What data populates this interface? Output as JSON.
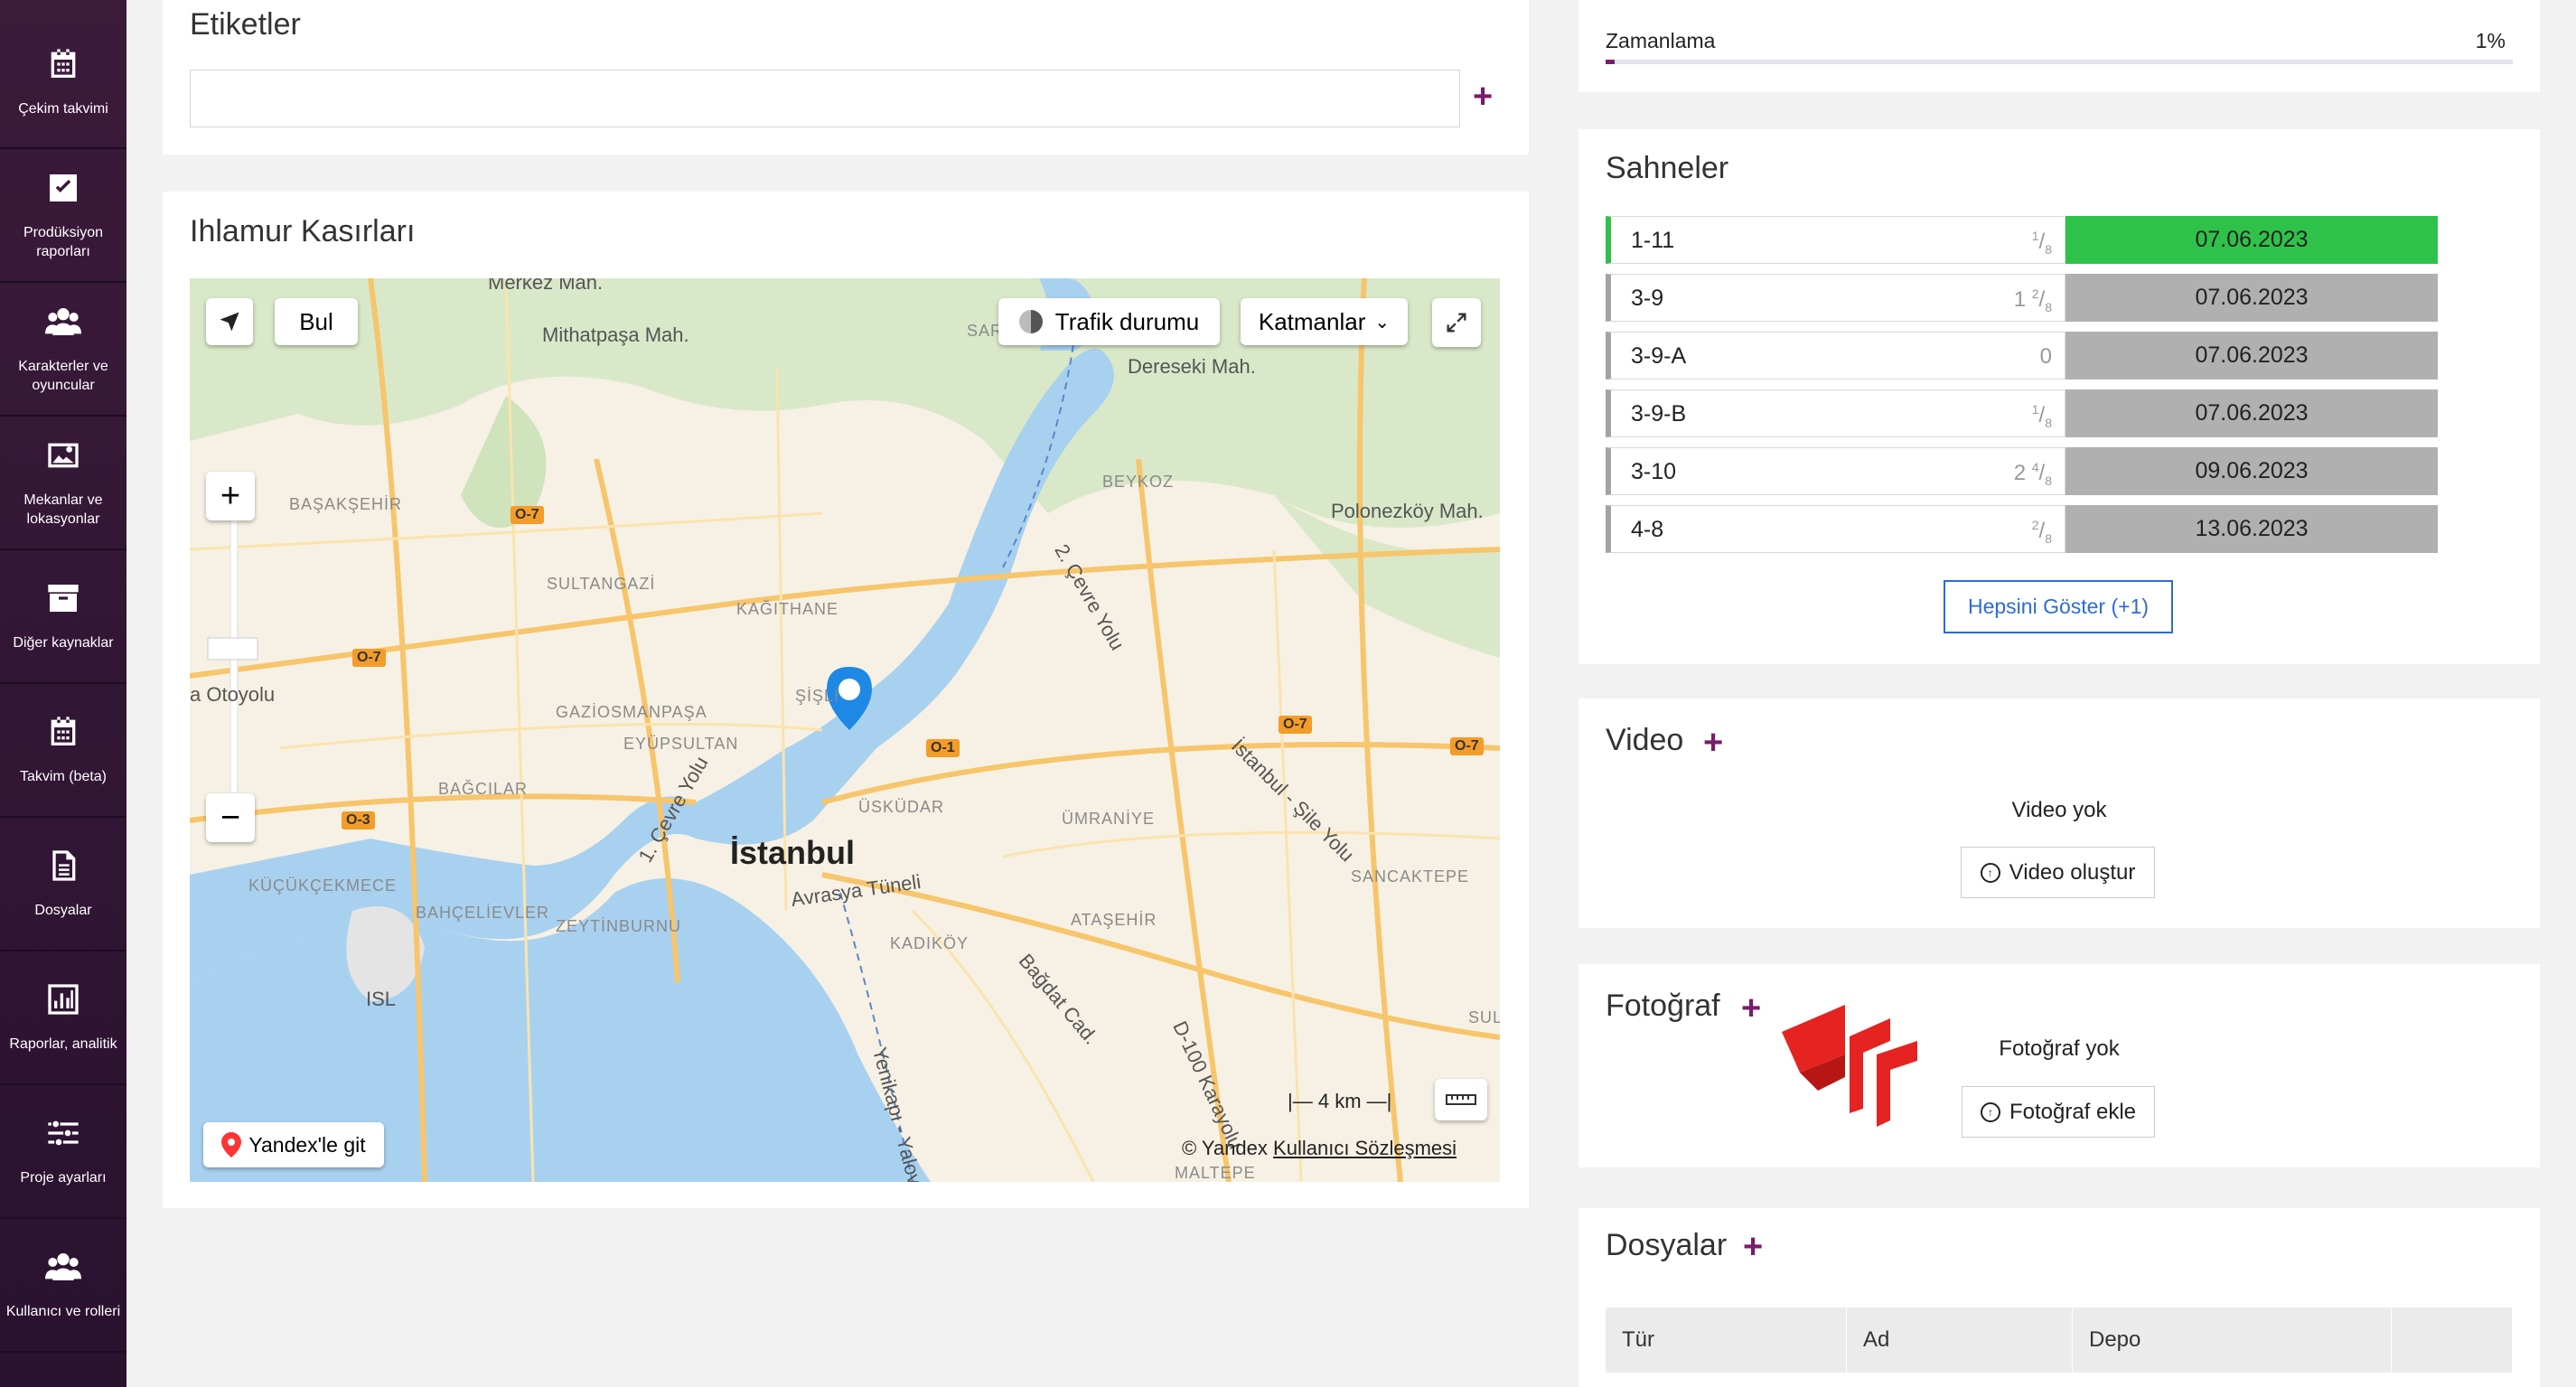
{
  "sidebar": {
    "items": [
      {
        "label": "Çekim takvimi",
        "icon": "calendar-icon"
      },
      {
        "label": "Prodüksiyon raporları",
        "icon": "checkbox-icon"
      },
      {
        "label": "Karakterler ve oyuncular",
        "icon": "users-icon"
      },
      {
        "label": "Mekanlar ve lokasyonlar",
        "icon": "image-icon"
      },
      {
        "label": "Diğer kaynaklar",
        "icon": "archive-icon"
      },
      {
        "label": "Takvim (beta)",
        "icon": "calendar-icon"
      },
      {
        "label": "Dosyalar",
        "icon": "document-icon"
      },
      {
        "label": "Raporlar, analitik",
        "icon": "bar-chart-icon"
      },
      {
        "label": "Proje ayarları",
        "icon": "sliders-icon"
      },
      {
        "label": "Kullanıcı ve rolleri",
        "icon": "users-icon"
      }
    ]
  },
  "tags": {
    "title": "Etiketler",
    "input_value": "",
    "add": "+"
  },
  "location": {
    "title": "Ihlamur Kasırları",
    "map": {
      "find_button": "Bul",
      "traffic_button": "Trafik durumu",
      "layers_button": "Katmanlar",
      "scale": "4 km",
      "yandex_button": "Yandex'le git",
      "copyright": "© Yandex",
      "terms_link": "Kullanıcı Sözleşmesi",
      "city_label": "İstanbul",
      "labels": [
        {
          "text": "Mithatpaşa Mah.",
          "cls": ""
        },
        {
          "text": "Dereseki Mah.",
          "cls": ""
        },
        {
          "text": "Polonezköy Mah.",
          "cls": ""
        },
        {
          "text": "BAŞAKŞEHİR",
          "cls": "small"
        },
        {
          "text": "SULTANGAZİ",
          "cls": "small"
        },
        {
          "text": "KAĞITHANE",
          "cls": "small"
        },
        {
          "text": "BEYKOZ",
          "cls": "small"
        },
        {
          "text": "GAZİOSMANPAŞA",
          "cls": "small"
        },
        {
          "text": "EYÜPSULTAN",
          "cls": "small"
        },
        {
          "text": "ŞİŞLİ",
          "cls": "small"
        },
        {
          "text": "BAĞCILAR",
          "cls": "small"
        },
        {
          "text": "ÜSKÜDAR",
          "cls": "small"
        },
        {
          "text": "ÜMRANİYE",
          "cls": "small"
        },
        {
          "text": "KÜÇÜKÇEKMECE",
          "cls": "small"
        },
        {
          "text": "BAHÇELİEVLER",
          "cls": "small"
        },
        {
          "text": "ZEYTİNBURNU",
          "cls": "small"
        },
        {
          "text": "KADIKÖY",
          "cls": "small"
        },
        {
          "text": "ATAŞEHİR",
          "cls": "small"
        },
        {
          "text": "SANCAKTEPE",
          "cls": "small"
        },
        {
          "text": "MALTEPE",
          "cls": "small"
        },
        {
          "text": "ISL",
          "cls": ""
        },
        {
          "text": "a Otoyolu",
          "cls": ""
        },
        {
          "text": "2. Çevre Yolu",
          "cls": ""
        },
        {
          "text": "1. Çevre Yolu",
          "cls": ""
        },
        {
          "text": "İstanbul - Şile Yolu",
          "cls": ""
        },
        {
          "text": "Avrasya Tüneli",
          "cls": ""
        },
        {
          "text": "Bağdat Cad.",
          "cls": ""
        },
        {
          "text": "D-100 Karayolu",
          "cls": ""
        },
        {
          "text": "Yenikapı - Yalova",
          "cls": ""
        },
        {
          "text": "SAR",
          "cls": "small"
        },
        {
          "text": "SUL",
          "cls": "small"
        },
        {
          "text": "Merkez Mah.",
          "cls": ""
        }
      ],
      "badges": [
        "O-7",
        "O-7",
        "O-7",
        "O-7",
        "O-3",
        "O-1"
      ]
    }
  },
  "schedule": {
    "label": "Zamanlama",
    "percent": "1%",
    "progress": 0.01
  },
  "scenes": {
    "title": "Sahneler",
    "rows": [
      {
        "name": "1-11",
        "whole": "",
        "num": "1",
        "den": "8",
        "date": "07.06.2023",
        "highlight": true
      },
      {
        "name": "3-9",
        "whole": "1",
        "num": "2",
        "den": "8",
        "date": "07.06.2023",
        "highlight": false
      },
      {
        "name": "3-9-A",
        "whole": "0",
        "num": "",
        "den": "",
        "date": "07.06.2023",
        "highlight": false
      },
      {
        "name": "3-9-B",
        "whole": "",
        "num": "1",
        "den": "8",
        "date": "07.06.2023",
        "highlight": false
      },
      {
        "name": "3-10",
        "whole": "2",
        "num": "4",
        "den": "8",
        "date": "09.06.2023",
        "highlight": false
      },
      {
        "name": "4-8",
        "whole": "",
        "num": "2",
        "den": "8",
        "date": "13.06.2023",
        "highlight": false
      }
    ],
    "show_all": "Hepsini Göster (+1)"
  },
  "video": {
    "title": "Video",
    "empty": "Video yok",
    "create": "Video oluştur"
  },
  "photo": {
    "title": "Fotoğraf",
    "empty": "Fotoğraf yok",
    "add": "Fotoğraf ekle"
  },
  "files": {
    "title": "Dosyalar",
    "columns": [
      "Tür",
      "Ad",
      "Depo",
      ""
    ]
  },
  "colors": {
    "accent": "#7a1c6c",
    "green": "#2fc24a",
    "link": "#2d6bd9",
    "logo": "#e52421"
  }
}
